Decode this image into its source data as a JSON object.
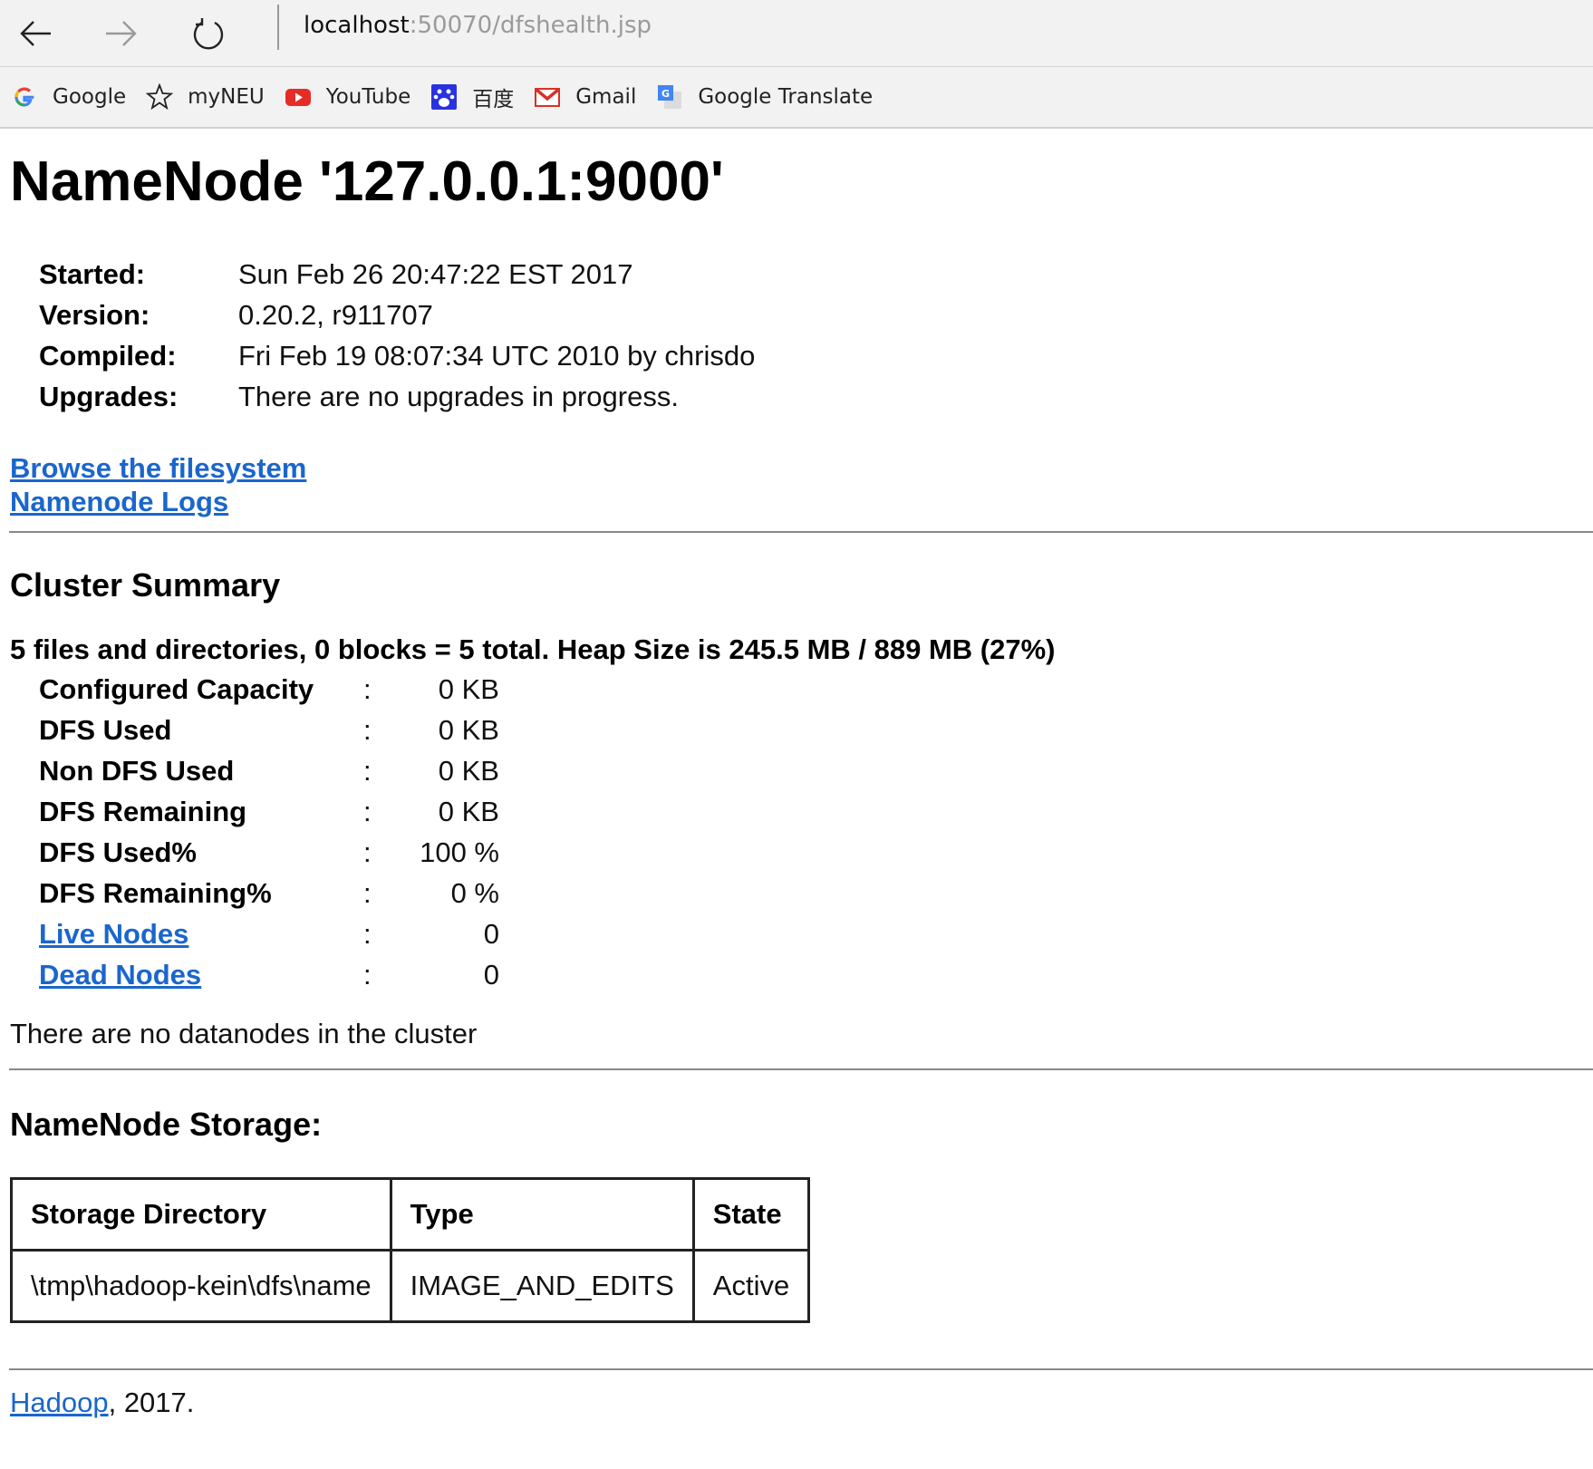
{
  "browser": {
    "url_host": "localhost",
    "url_path": ":50070/dfshealth.jsp",
    "bookmarks": [
      {
        "label": "Google",
        "icon": "google-icon"
      },
      {
        "label": "myNEU",
        "icon": "star-icon"
      },
      {
        "label": "YouTube",
        "icon": "youtube-icon"
      },
      {
        "label": "百度",
        "icon": "baidu-icon"
      },
      {
        "label": "Gmail",
        "icon": "gmail-icon"
      },
      {
        "label": "Google Translate",
        "icon": "google-translate-icon"
      }
    ]
  },
  "page": {
    "title": "NameNode '127.0.0.1:9000'",
    "info": [
      {
        "key": "Started:",
        "value": "Sun Feb 26 20:47:22 EST 2017"
      },
      {
        "key": "Version:",
        "value": "0.20.2, r911707"
      },
      {
        "key": "Compiled:",
        "value": "Fri Feb 19 08:07:34 UTC 2010 by chrisdo"
      },
      {
        "key": "Upgrades:",
        "value": "There are no upgrades in progress."
      }
    ],
    "links": {
      "browse": "Browse the filesystem",
      "logs": "Namenode Logs"
    },
    "cluster_summary": {
      "heading": "Cluster Summary",
      "summary_line": "5 files and directories, 0 blocks = 5 total. Heap Size is 245.5 MB / 889 MB (27%)",
      "separator": ":",
      "stats": [
        {
          "key": "Configured Capacity",
          "value": "0 KB"
        },
        {
          "key": "DFS Used",
          "value": "0 KB"
        },
        {
          "key": "Non DFS Used",
          "value": "0 KB"
        },
        {
          "key": "DFS Remaining",
          "value": "0 KB"
        },
        {
          "key": "DFS Used%",
          "value": "100 %"
        },
        {
          "key": "DFS Remaining%",
          "value": "0 %"
        },
        {
          "key": "Live Nodes",
          "value": "0"
        },
        {
          "key": "Dead Nodes",
          "value": "0"
        }
      ],
      "no_datanodes": "There are no datanodes in the cluster"
    },
    "storage": {
      "heading": "NameNode Storage:",
      "headers": [
        "Storage Directory",
        "Type",
        "State"
      ],
      "rows": [
        [
          "\\tmp\\hadoop-kein\\dfs\\name",
          "IMAGE_AND_EDITS",
          "Active"
        ]
      ]
    },
    "footer": {
      "link": "Hadoop",
      "text": ", 2017."
    }
  },
  "colors": {
    "link": "#1a66cc",
    "chrome_bg": "#f2f2f2"
  }
}
